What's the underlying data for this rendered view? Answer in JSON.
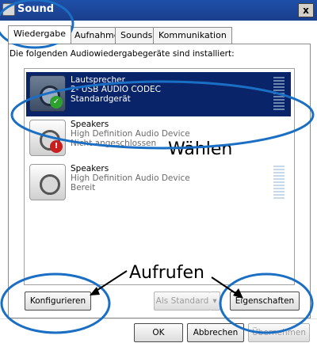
{
  "window": {
    "title": "Sound",
    "close_label": "x"
  },
  "tabs": [
    {
      "label": "Wiedergabe",
      "active": true
    },
    {
      "label": "Aufnahme",
      "active": false
    },
    {
      "label": "Sounds",
      "active": false
    },
    {
      "label": "Kommunikation",
      "active": false
    }
  ],
  "panel": {
    "intro": "Die folgenden Audiowiedergabegeräte sind installiert:"
  },
  "devices": [
    {
      "name": "Lautsprecher",
      "detail": "2- USB AUDIO  CODEC",
      "status": "Standardgerät",
      "badge": "check"
    },
    {
      "name": "Speakers",
      "detail": "High Definition Audio Device",
      "status": "Nicht angeschlossen",
      "badge": "warning"
    },
    {
      "name": "Speakers",
      "detail": "High Definition Audio Device",
      "status": "Bereit",
      "badge": ""
    }
  ],
  "buttons": {
    "configure": "Konfigurieren",
    "set_default": "Als Standard",
    "properties": "Eigenschaften",
    "ok": "OK",
    "cancel": "Abbrechen",
    "apply": "Übernehmen"
  },
  "annotations": {
    "choose": "Wählen",
    "call_up": "Aufrufen"
  },
  "colors": {
    "selection": "#0a246a",
    "annotation_outline": "#1a6fc4",
    "title_bar": "#1f4fa8"
  }
}
